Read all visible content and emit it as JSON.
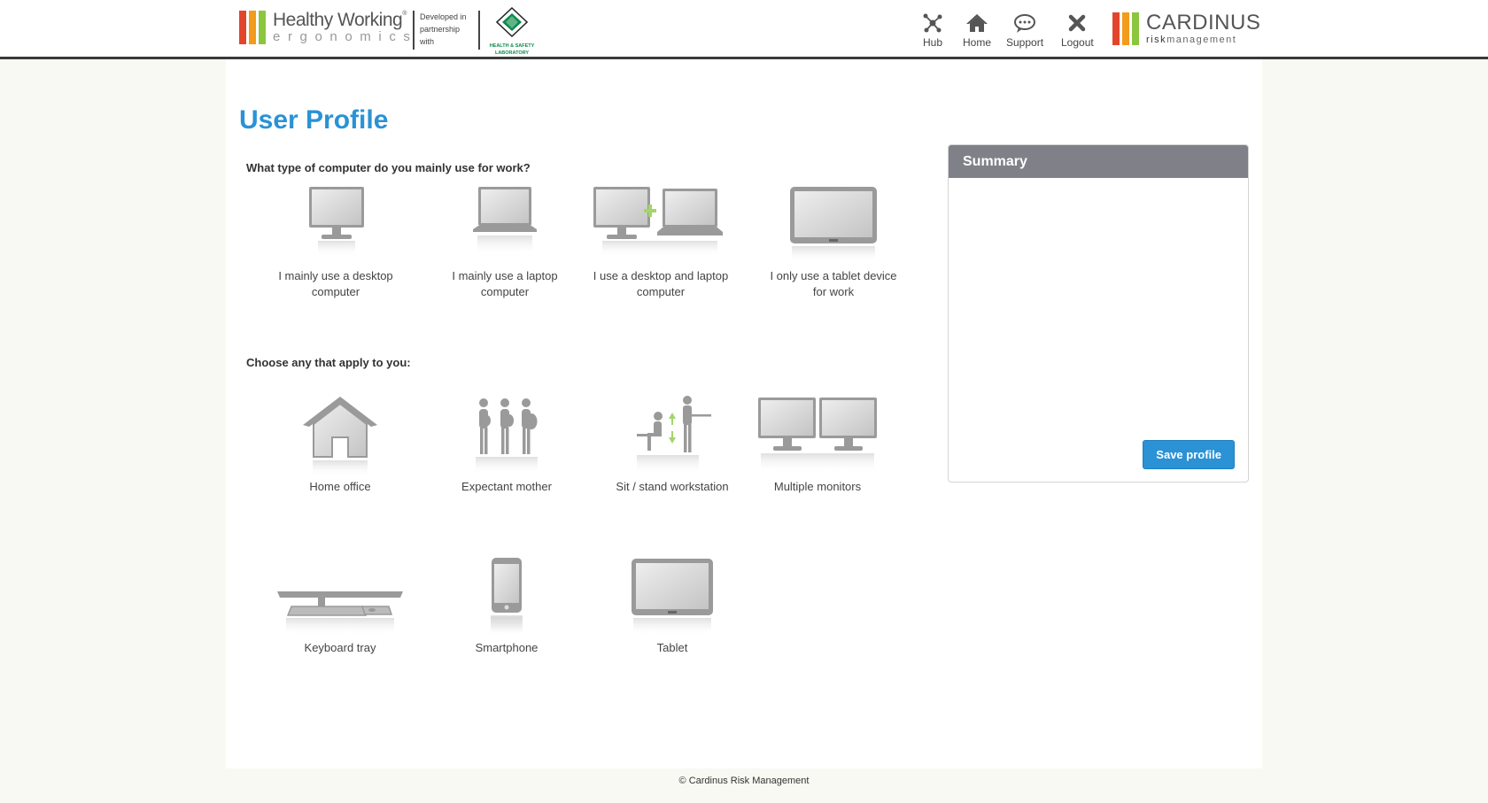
{
  "header": {
    "logo_title": "Healthy Working",
    "logo_sub": "ergonomics",
    "logo_colors": [
      "#e2452b",
      "#f29b1d",
      "#8cc63f"
    ],
    "partner_text": [
      "Developed in",
      "partnership",
      "with"
    ],
    "partner_caption": [
      "HEALTH & SAFETY",
      "LABORATORY"
    ],
    "nav": [
      {
        "label": "Hub",
        "icon": "hub-icon"
      },
      {
        "label": "Home",
        "icon": "home-icon"
      },
      {
        "label": "Support",
        "icon": "support-icon"
      },
      {
        "label": "Logout",
        "icon": "close-icon"
      }
    ],
    "brand_name": "CARDINUS",
    "brand_sub_bold": "risk",
    "brand_sub_rest": "management"
  },
  "page": {
    "title": "User Profile",
    "q1": "What type of computer do you mainly use for work?",
    "q1_options": [
      {
        "line1": "I mainly use a desktop",
        "line2": "computer",
        "icon": "desktop-icon"
      },
      {
        "line1": "I mainly use a laptop",
        "line2": "computer",
        "icon": "laptop-icon"
      },
      {
        "line1": "I use a desktop and laptop",
        "line2": "computer",
        "icon": "desktop-laptop-icon"
      },
      {
        "line1": "I only use a tablet device",
        "line2": "for work",
        "icon": "tablet-icon"
      }
    ],
    "q2": "Choose any that apply to you:",
    "q2_options": [
      {
        "label": "Home office",
        "icon": "home-office-icon"
      },
      {
        "label": "Expectant mother",
        "icon": "expectant-mother-icon"
      },
      {
        "label": "Sit / stand workstation",
        "icon": "sit-stand-icon"
      },
      {
        "label": "Multiple monitors",
        "icon": "multiple-monitors-icon"
      },
      {
        "label": "Keyboard tray",
        "icon": "keyboard-tray-icon"
      },
      {
        "label": "Smartphone",
        "icon": "smartphone-icon"
      },
      {
        "label": "Tablet",
        "icon": "tablet-icon"
      }
    ]
  },
  "summary": {
    "title": "Summary",
    "save_label": "Save profile"
  },
  "footer": {
    "copyright": "© Cardinus Risk Management"
  },
  "colors": {
    "accent": "#2a92d5",
    "summary_header": "#808088",
    "icon_gray": "#9a9a9a",
    "icon_green": "#a5d46a"
  }
}
